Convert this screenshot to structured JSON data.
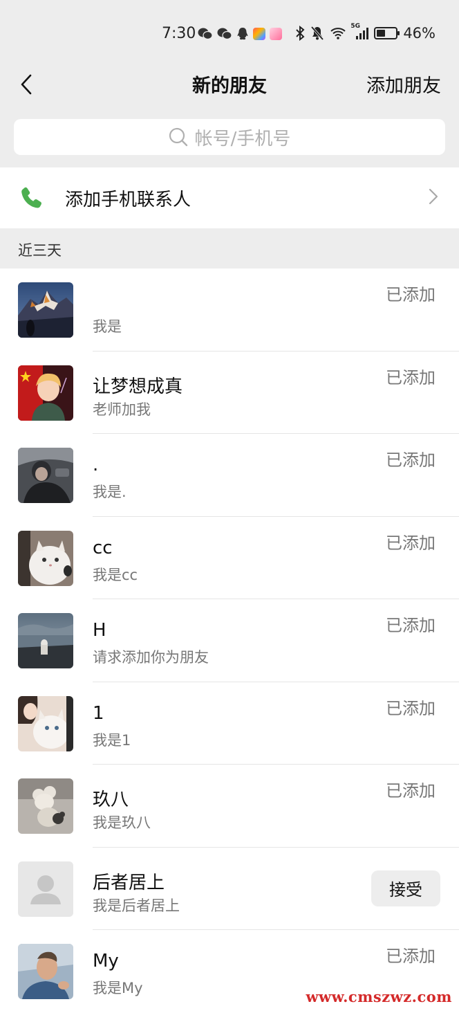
{
  "status_bar": {
    "time": "7:30",
    "network": "5G",
    "battery": "46%",
    "battery_level": 0.46,
    "icons": [
      "wechat-icon",
      "wechat-icon",
      "qq-icon",
      "app-icon",
      "app-icon",
      "bluetooth-icon",
      "mute-icon",
      "wifi-icon",
      "signal-icon",
      "battery-icon"
    ]
  },
  "header": {
    "title": "新的朋友",
    "add_friend": "添加朋友",
    "back_icon": "back-chevron-icon"
  },
  "search": {
    "placeholder": "帐号/手机号",
    "icon": "search-icon"
  },
  "phone_contacts": {
    "label": "添加手机联系人",
    "icon": "phone-icon"
  },
  "section": {
    "title": "近三天"
  },
  "requests": [
    {
      "name": "",
      "message": "我是",
      "status": "已添加",
      "avatar": "mountain-photo"
    },
    {
      "name": "让梦想成真",
      "message": "老师加我",
      "status": "已添加",
      "avatar": "anime-boy"
    },
    {
      "name": ".",
      "message": "我是.",
      "status": "已添加",
      "avatar": "car-selfie"
    },
    {
      "name": "cc",
      "message": "我是cc",
      "status": "已添加",
      "avatar": "white-cat"
    },
    {
      "name": "H",
      "message": "请求添加你为朋友",
      "status": "已添加",
      "avatar": "seaside-photo"
    },
    {
      "name": "1",
      "message": "我是1",
      "status": "已添加",
      "avatar": "girl-with-cat"
    },
    {
      "name": "玖八",
      "message": "我是玖八",
      "status": "已添加",
      "avatar": "plush-toy"
    },
    {
      "name": "后者居上",
      "message": "我是后者居上",
      "button": "接受",
      "avatar": "default-avatar"
    },
    {
      "name": "My",
      "message": "我是My",
      "status": "已添加",
      "avatar": "man-photo"
    }
  ],
  "watermark": "www.cmszwz.com",
  "colors": {
    "background_gray": "#ededed",
    "phone_green": "#4caf50",
    "secondary_text": "#777777",
    "watermark_red": "#d42a2a"
  }
}
